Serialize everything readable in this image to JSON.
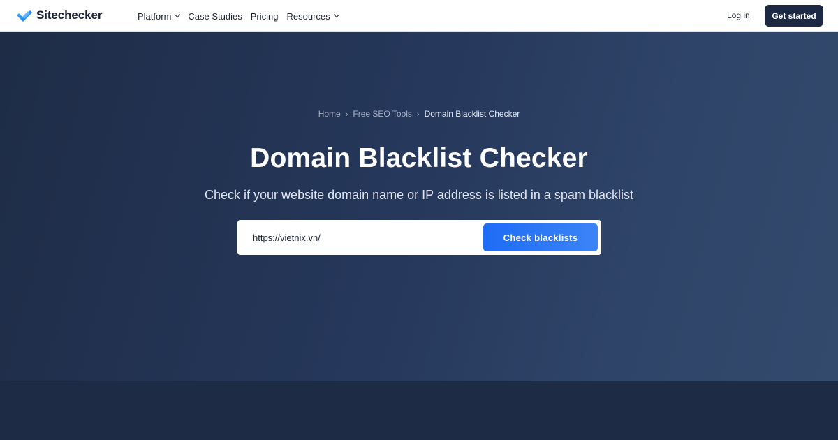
{
  "brand": {
    "name": "Sitechecker",
    "accent": "#1e8bff"
  },
  "nav": {
    "items": [
      {
        "label": "Platform",
        "dropdown": true
      },
      {
        "label": "Case Studies",
        "dropdown": false
      },
      {
        "label": "Pricing",
        "dropdown": false
      },
      {
        "label": "Resources",
        "dropdown": true
      }
    ],
    "login": "Log in",
    "cta": "Get started"
  },
  "breadcrumb": [
    "Home",
    "Free SEO Tools",
    "Domain Blacklist Checker"
  ],
  "hero": {
    "title": "Domain Blacklist Checker",
    "subtitle": "Check if your website domain name or IP address is listed in a spam blacklist"
  },
  "search": {
    "value": "https://vietnix.vn/",
    "button": "Check blacklists"
  },
  "colors": {
    "header_bg": "#ffffff",
    "hero_bg_start": "#1e2c46",
    "hero_bg_end": "#344a6d",
    "cta_bg": "#1d2942",
    "button_blue": "#1f6cf5"
  }
}
